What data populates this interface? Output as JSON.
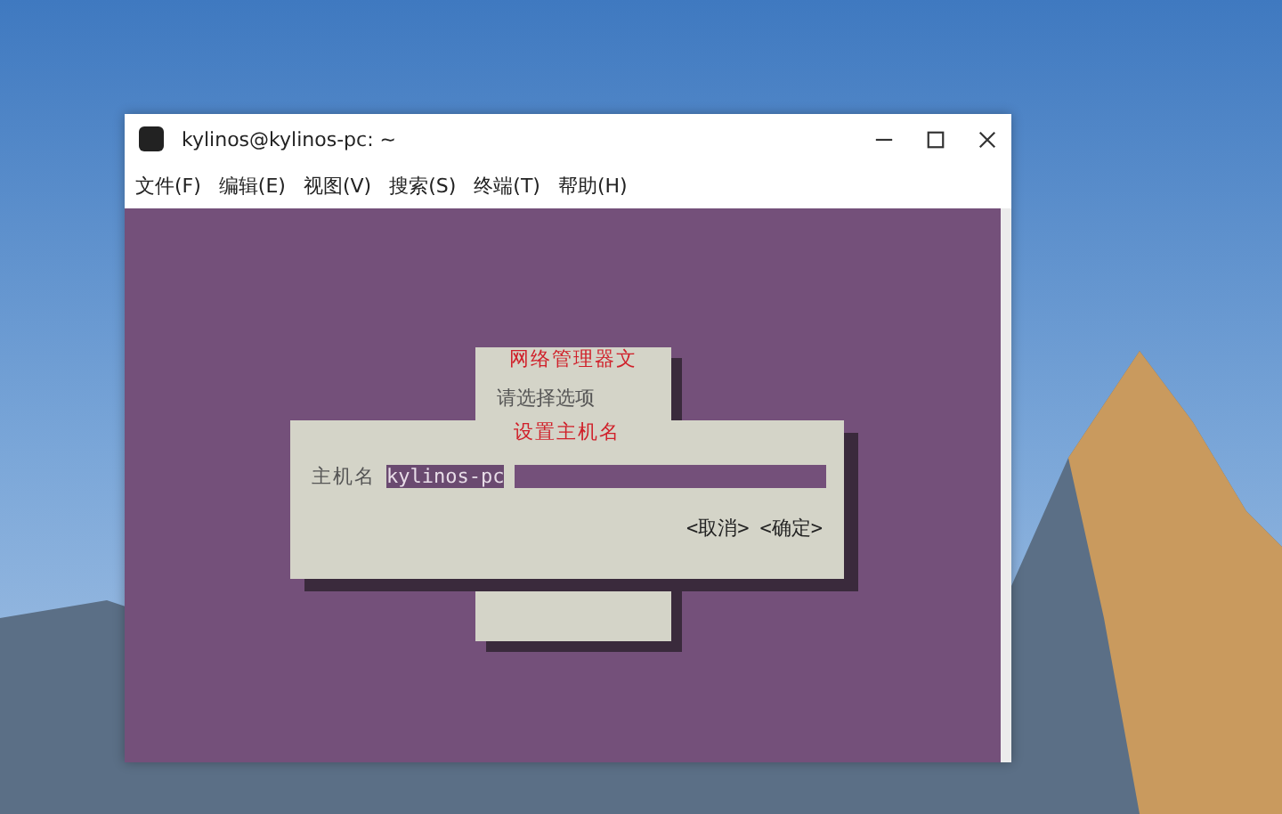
{
  "window": {
    "title": "kylinos@kylinos-pc: ~"
  },
  "menu": [
    "文件(F)",
    "编辑(E)",
    "视图(V)",
    "搜索(S)",
    "终端(T)",
    "帮助(H)"
  ],
  "terminal": {
    "back_dialog": {
      "title": "网络管理器文",
      "prompt": "请选择选项"
    },
    "dialog": {
      "title": "设置主机名",
      "field": {
        "label": "主机名",
        "value": "kylinos-pc"
      },
      "buttons": [
        "<取消>",
        "<确定>"
      ]
    }
  }
}
